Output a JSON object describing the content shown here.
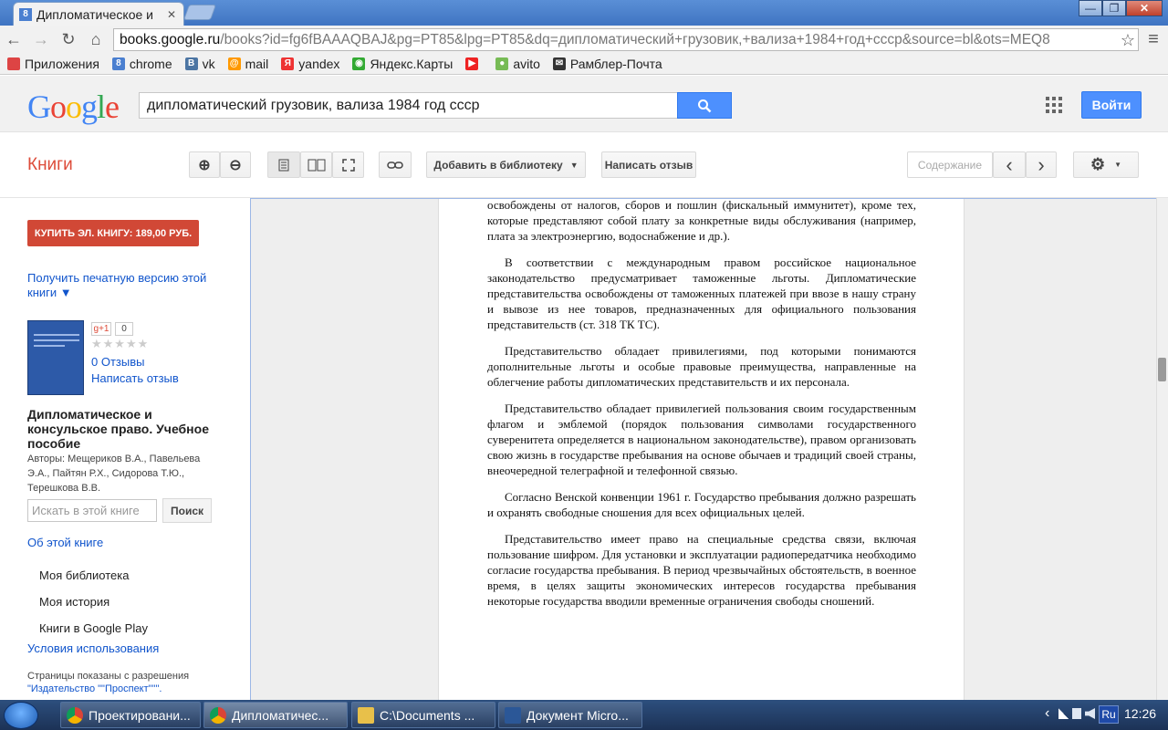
{
  "window": {
    "tab_title": "Дипломатическое и",
    "tab_fav": "8",
    "minimize": "—",
    "restore": "❐",
    "close": "✕"
  },
  "toolbar": {
    "url_host": "books.google.ru",
    "url_rest": "/books?id=fg6fBAAAQBAJ&pg=PT85&lpg=PT85&dq=дипломатический+грузовик,+вализа+1984+год+ссср&source=bl&ots=MEQ8",
    "back": "←",
    "forward": "→",
    "reload": "↻",
    "home": "⌂",
    "star": "☆",
    "menu": "≡"
  },
  "bookmarks": [
    {
      "label": "Приложения",
      "icon": "apps-icon",
      "color": "#d44"
    },
    {
      "label": "chrome",
      "icon": "8",
      "color": "#4a7fd0"
    },
    {
      "label": "vk",
      "icon": "B",
      "color": "#4c75a3"
    },
    {
      "label": "mail",
      "icon": "@",
      "color": "#f90"
    },
    {
      "label": "yandex",
      "icon": "Я",
      "color": "#e33"
    },
    {
      "label": "Яндекс.Карты",
      "icon": "◉",
      "color": "#3a3"
    },
    {
      "label": "",
      "icon": "▶",
      "color": "#e22"
    },
    {
      "label": "avito",
      "icon": "●",
      "color": "#7b5"
    },
    {
      "label": "Рамблер-Почта",
      "icon": "✉",
      "color": "#333"
    }
  ],
  "google": {
    "search_query": "дипломатический грузовик, вализа 1984 год ссср",
    "login": "Войти"
  },
  "books_bar": {
    "title": "Книги",
    "zoom_in": "⊕",
    "zoom_out": "⊖",
    "add_library": "Добавить в библиотеку",
    "write_review": "Написать отзыв",
    "contents": "Содержание",
    "prev": "‹",
    "next": "›",
    "settings": "⚙"
  },
  "sidebar": {
    "buy": "КУПИТЬ ЭЛ. КНИГУ: 189,00 РУБ.",
    "print_version": "Получить печатную версию этой книги ▼",
    "gplus": "g+1",
    "gplus_count": "0",
    "stars": "★★★★★",
    "reviews": "0 Отзывы",
    "write_review": "Написать отзыв",
    "title": "Дипломатическое и консульское право. Учебное пособие",
    "authors": "Авторы: Мещериков В.А., Павельева Э.А., Пайтян Р.Х., Сидорова Т.Ю., Терешкова В.В.",
    "search_placeholder": "Искать в этой книге",
    "search_button": "Поиск",
    "about": "Об этой книге",
    "my_library": "Моя библиотека",
    "my_history": "Моя история",
    "google_play": "Книги в Google Play",
    "terms": "Условия использования",
    "publisher_note": "Страницы показаны с разрешения",
    "publisher": "\"Издательство \"\"Проспект\"\"\"."
  },
  "page": {
    "paragraphs": [
      "освобождены от налогов, сборов и пошлин (фискальный иммунитет), кроме тех, которые представляют собой плату за конкретные виды обслуживания (например, плата за электроэнергию, водоснабжение и др.).",
      "В соответствии с международным правом российское национальное законодательство предусматривает таможенные льготы. Дипломатические представительства освобождены от таможенных платежей при ввозе в нашу страну и вывозе из нее товаров, предназначенных для официального пользования представительств (ст. 318 ТК ТС).",
      "Представительство обладает привилегиями, под которыми понимаются дополнительные льготы и особые правовые преимущества, направленные на облегчение работы дипломатических представительств и их персонала.",
      "Представительство обладает привилегией пользования своим государственным флагом и эмблемой (порядок пользования символами государственного суверенитета определяется в национальном законодательстве), правом организовать свою жизнь в государстве пребывания на основе обычаев и традиций своей страны, внеочередной телеграфной и телефонной связью.",
      "Согласно Венской конвенции 1961 г. Государство пребывания должно разрешать и охранять свободные сношения для всех официальных целей.",
      "Представительство имеет право на специальные средства связи, включая пользование шифром. Для установки и эксплуатации радиопередатчика необходимо согласие государства пребывания. В период чрезвычайных обстоятельств, в военное время, в целях защиты экономических интересов государства пребывания некоторые государства вводили временные ограничения свободы сношений."
    ]
  },
  "taskbar": {
    "tasks": [
      "Проектировани...",
      "Дипломатичес...",
      "C:\\Documents ...",
      "Документ Micro..."
    ],
    "lang": "Ru",
    "clock": "12:26",
    "tray_arrow": "‹"
  }
}
